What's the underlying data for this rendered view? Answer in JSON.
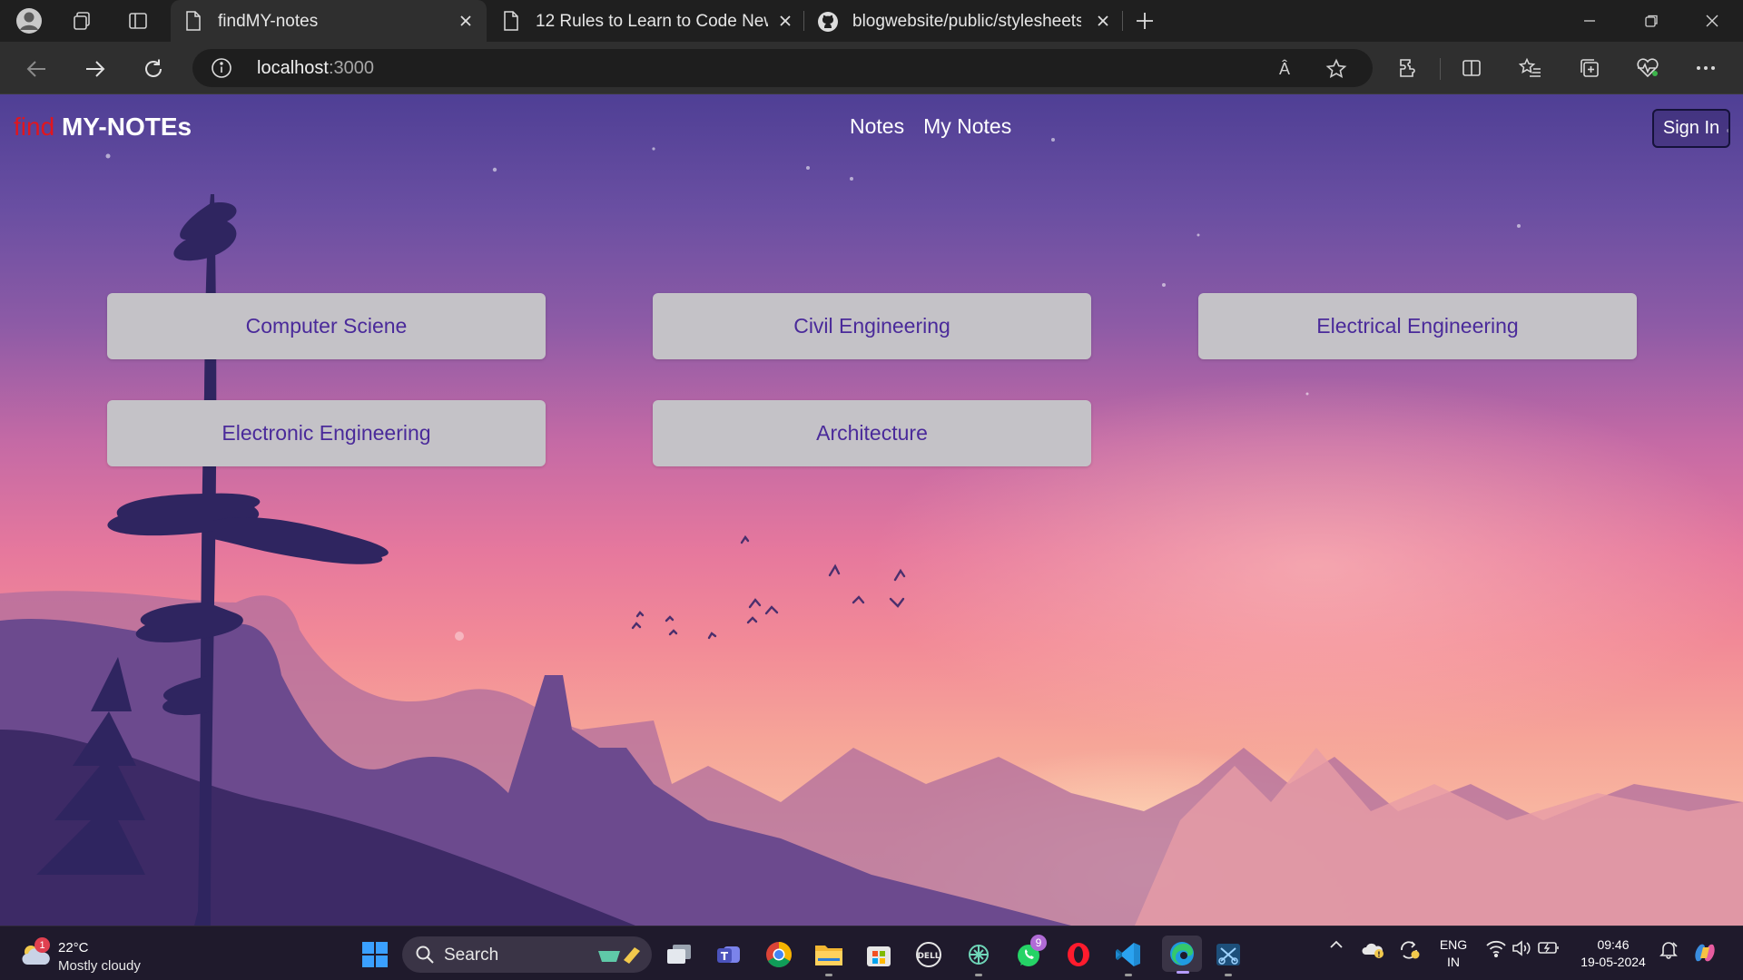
{
  "browser": {
    "tabs": [
      {
        "title": "findMY-notes",
        "active": true
      },
      {
        "title": "12 Rules to Learn to Code New T",
        "active": false
      },
      {
        "title": "blogwebsite/public/stylesheets/s",
        "active": false
      }
    ],
    "address": {
      "host": "localhost",
      "port": ":3000"
    },
    "read_aloud_label": "Â"
  },
  "site": {
    "logo": {
      "prefix": "find",
      "name": "MY-NOTEs"
    },
    "nav": [
      {
        "label": "Notes"
      },
      {
        "label": "My Notes"
      }
    ],
    "sign_in_label": "Sign In",
    "subjects": [
      {
        "label": "Computer Sciene"
      },
      {
        "label": "Civil Engineering"
      },
      {
        "label": "Electrical Engineering"
      },
      {
        "label": "Electronic Engineering"
      },
      {
        "label": "Architecture"
      }
    ],
    "colors": {
      "logo_prefix": "#e0161f",
      "card_bg": "#c4c2c7",
      "card_text": "#4a2a9a"
    }
  },
  "taskbar": {
    "weather": {
      "temp": "22°C",
      "desc": "Mostly cloudy",
      "badge": "1"
    },
    "search_label": "Search",
    "whatsapp_badge": "9",
    "language": {
      "line1": "ENG",
      "line2": "IN"
    },
    "clock": {
      "time": "09:46",
      "date": "19-05-2024"
    }
  }
}
